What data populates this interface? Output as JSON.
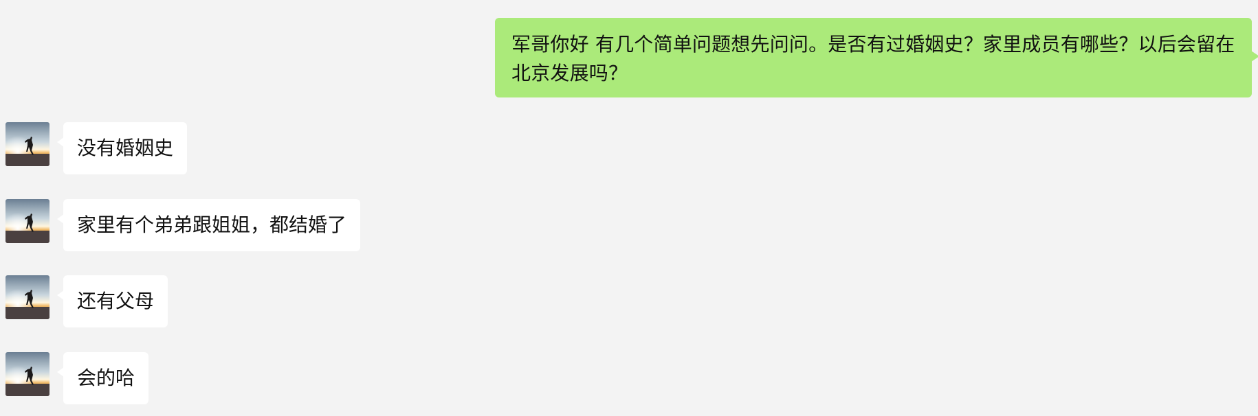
{
  "chat": {
    "outgoing": [
      {
        "text": "军哥你好 有几个简单问题想先问问。是否有过婚姻史？家里成员有哪些？以后会留在北京发展吗？"
      }
    ],
    "incoming": [
      {
        "text": "没有婚姻史",
        "avatar": "runner-sunset-avatar"
      },
      {
        "text": "家里有个弟弟跟姐姐，都结婚了",
        "avatar": "runner-sunset-avatar"
      },
      {
        "text": "还有父母",
        "avatar": "runner-sunset-avatar"
      },
      {
        "text": "会的哈",
        "avatar": "runner-sunset-avatar"
      }
    ]
  },
  "colors": {
    "background": "#f3f3f3",
    "outgoing_bubble": "#abea7a",
    "incoming_bubble": "#ffffff"
  }
}
